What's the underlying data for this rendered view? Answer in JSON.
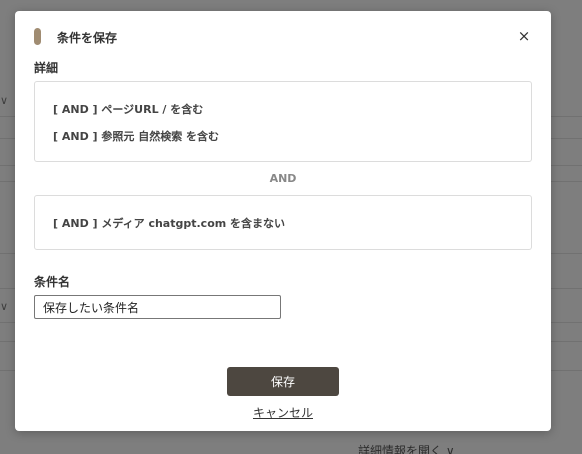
{
  "modal": {
    "title": "条件を保存",
    "close_icon": "×",
    "details_label": "詳細",
    "condition_groups": [
      {
        "lines": [
          "[ AND ] ページURL / を含む",
          "[ AND ] 参照元 自然検索 を含む"
        ]
      },
      {
        "lines": [
          "[ AND ] メディア chatgpt.com を含まない"
        ]
      }
    ],
    "group_separator": "AND",
    "name_label": "条件名",
    "name_input_value": "保存したい条件名",
    "save_label": "保存",
    "cancel_label": "キャンセル"
  },
  "background": {
    "link_text": "詳細情報を開く ∨"
  },
  "colors": {
    "title_accent": "#a08c72",
    "save_button_bg": "#4d4740"
  }
}
